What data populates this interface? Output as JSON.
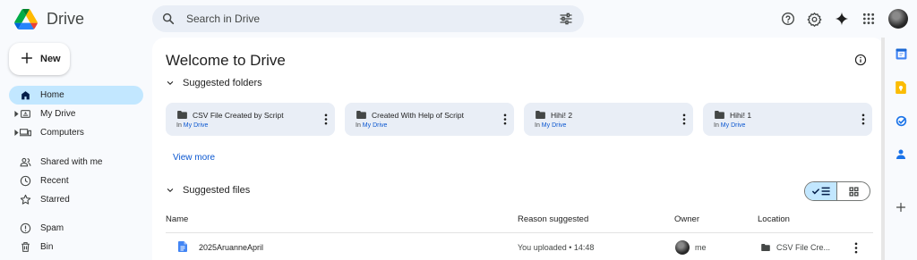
{
  "app": {
    "name": "Drive"
  },
  "search": {
    "placeholder": "Search in Drive"
  },
  "sidebar": {
    "new_label": "New",
    "items": [
      {
        "label": "Home",
        "icon": "home-icon",
        "active": true
      },
      {
        "label": "My Drive",
        "icon": "my-drive-icon"
      },
      {
        "label": "Computers",
        "icon": "computers-icon"
      },
      {
        "label": "Shared with me",
        "icon": "shared-icon"
      },
      {
        "label": "Recent",
        "icon": "clock-icon"
      },
      {
        "label": "Starred",
        "icon": "star-icon"
      },
      {
        "label": "Spam",
        "icon": "spam-icon"
      },
      {
        "label": "Bin",
        "icon": "bin-icon"
      }
    ]
  },
  "main": {
    "title": "Welcome to Drive",
    "suggested_folders_label": "Suggested folders",
    "folders": [
      {
        "name": "CSV File Created by Script",
        "location_prefix": "In",
        "location": "My Drive"
      },
      {
        "name": "Created With Help of Script",
        "location_prefix": "In",
        "location": "My Drive"
      },
      {
        "name": "Hihi! 2",
        "location_prefix": "In",
        "location": "My Drive"
      },
      {
        "name": "Hihi! 1",
        "location_prefix": "In",
        "location": "My Drive"
      }
    ],
    "view_more": "View more",
    "suggested_files_label": "Suggested files",
    "columns": {
      "name": "Name",
      "reason": "Reason suggested",
      "owner": "Owner",
      "location": "Location"
    },
    "files": [
      {
        "name": "2025AruanneApril",
        "reason": "You uploaded • 14:48",
        "owner": "me",
        "location": "CSV File Cre..."
      }
    ]
  },
  "colors": {
    "accent": "#0b57d0",
    "active_nav": "#c2e7ff",
    "search_bg": "#e9eef6"
  }
}
